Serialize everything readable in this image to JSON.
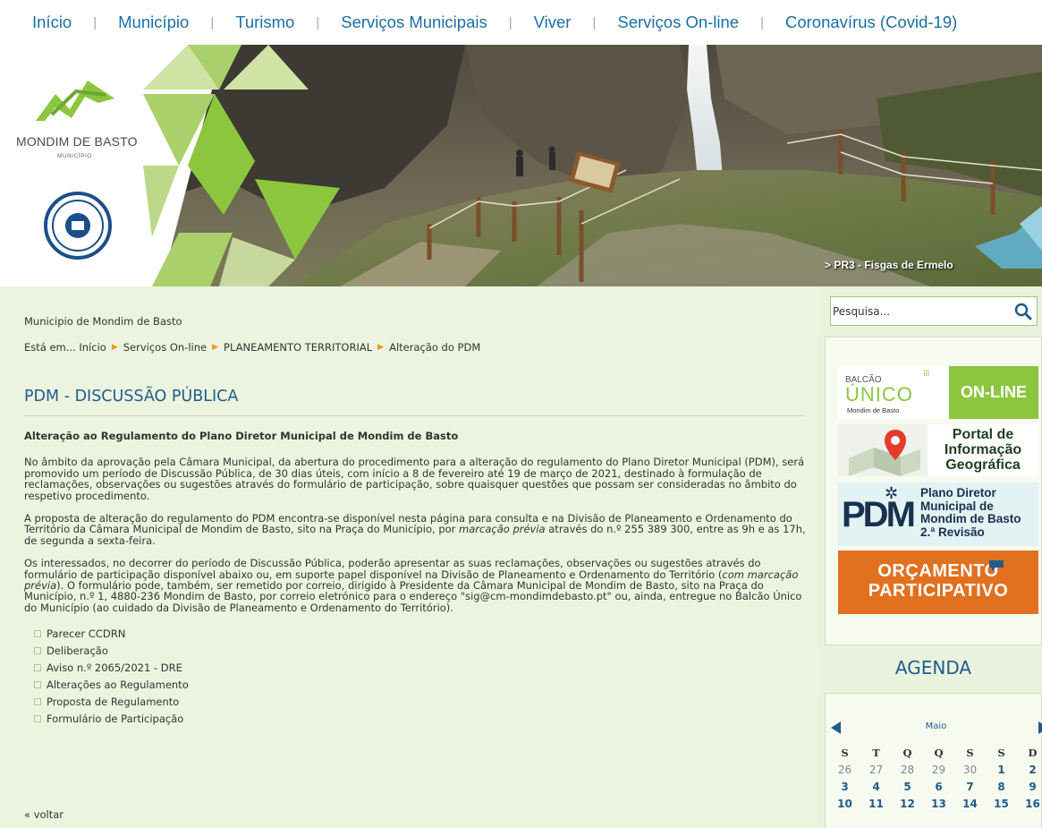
{
  "nav": {
    "items": [
      "Início",
      "Município",
      "Turismo",
      "Serviços Municipais",
      "Viver",
      "Serviços On-line",
      "Coronavírus (Covid-19)"
    ],
    "separator": "|"
  },
  "banner": {
    "logo_title": "MONDIM DE BASTO",
    "logo_subtitle": "MUNICÍPIO",
    "caption": "> PR3 - Fisgas de Ermelo"
  },
  "main": {
    "site_name": "Municipio de Mondim de Basto",
    "breadcrumb": {
      "prefix": "Está em...",
      "items": [
        "Início",
        "Serviços On-line",
        "PLANEAMENTO TERRITORIAL",
        "Alteração do PDM"
      ]
    },
    "title": "PDM - DISCUSSÃO PÚBLICA",
    "heading": "Alteração ao Regulamento do Plano Diretor Municipal de Mondim de Basto",
    "para1": "No âmbito da aprovação pela Câmara Municipal, da abertura do procedimento para a alteração do regulamento do Plano Diretor Municipal (PDM), será promovido um período de Discussão Pública, de 30 dias úteis, com início a 8 de fevereiro até 19 de março de 2021, destinado à formulação de reclamações, observações ou sugestões através do formulário de participação, sobre quaisquer questões que possam ser consideradas no âmbito do respetivo procedimento.",
    "para2_a": "A proposta de alteração do regulamento do PDM encontra-se disponível nesta página para consulta e na Divisão de Planeamento e Ordenamento do Território da Câmara Municipal de Mondim de Basto, sito na Praça do Município, por ",
    "para2_em": "marcação prévia",
    "para2_b": " através do n.º 255 389 300, entre as 9h e as 17h, de segunda a sexta-feira.",
    "para3_a": "Os interessados, no decorrer do período de Discussão Pública, poderão apresentar as suas reclamações, observações ou sugestões através do formulário de participação disponível abaixo ou, em suporte papel disponível na Divisão de Planeamento e Ordenamento do Território (",
    "para3_em": "com marcação prévia",
    "para3_b": "). O formulário pode, também, ser remetido por correio, dirigido à Presidente da Câmara Municipal de Mondim de Basto, sito na Praça do Município, n.º 1, 4880-236 Mondim de Basto, por correio eletrónico para o endereço \"sig@cm-mondimdebasto.pt\" ou, ainda, entregue no Balcão Único do Município (ao cuidado da Divisão de Planeamento e Ordenamento do Território).",
    "documents": [
      "Parecer CCDRN",
      "Deliberação",
      "Aviso n.º 2065/2021 - DRE",
      "Alterações ao Regulamento",
      "Proposta de Regulamento",
      "Formulário de Participação"
    ],
    "back": "« voltar"
  },
  "sidebar": {
    "search_placeholder": "Pesquisa...",
    "promos": {
      "balcao": {
        "line1": "BALCÃO",
        "line2": "ÚNICO",
        "line3": "Mondim de Basto",
        "cta": "ON-LINE"
      },
      "portal": {
        "line1": "Portal de",
        "line2": "Informação",
        "line3": "Geográfica"
      },
      "pdm": {
        "logo": "PDM",
        "line1": "Plano Diretor",
        "line2": "Municipal de",
        "line3": "Mondim de Basto",
        "line4": "2.ª Revisão"
      },
      "orcamento": {
        "line1": "ORÇAMENTO",
        "line2": "PARTICIPATIVO"
      }
    },
    "agenda_title": "AGENDA",
    "calendar": {
      "month": "Maio",
      "weekdays": [
        "S",
        "T",
        "Q",
        "Q",
        "S",
        "S",
        "D"
      ],
      "weeks": [
        [
          {
            "d": "26",
            "o": true
          },
          {
            "d": "27",
            "o": true
          },
          {
            "d": "28",
            "o": true
          },
          {
            "d": "29",
            "o": true
          },
          {
            "d": "30",
            "o": true
          },
          {
            "d": "1",
            "o": false
          },
          {
            "d": "2",
            "o": false
          }
        ],
        [
          {
            "d": "3",
            "o": false
          },
          {
            "d": "4",
            "o": false
          },
          {
            "d": "5",
            "o": false
          },
          {
            "d": "6",
            "o": false
          },
          {
            "d": "7",
            "o": false
          },
          {
            "d": "8",
            "o": false
          },
          {
            "d": "9",
            "o": false
          }
        ],
        [
          {
            "d": "10",
            "o": false
          },
          {
            "d": "11",
            "o": false
          },
          {
            "d": "12",
            "o": false
          },
          {
            "d": "13",
            "o": false
          },
          {
            "d": "14",
            "o": false
          },
          {
            "d": "15",
            "o": false
          },
          {
            "d": "16",
            "o": false
          }
        ]
      ]
    }
  },
  "colors": {
    "link": "#1b6ea8",
    "title": "#1f5c8c",
    "bg": "#e9f2dc",
    "accent_green": "#8cc63f",
    "accent_orange": "#e79a1e"
  }
}
